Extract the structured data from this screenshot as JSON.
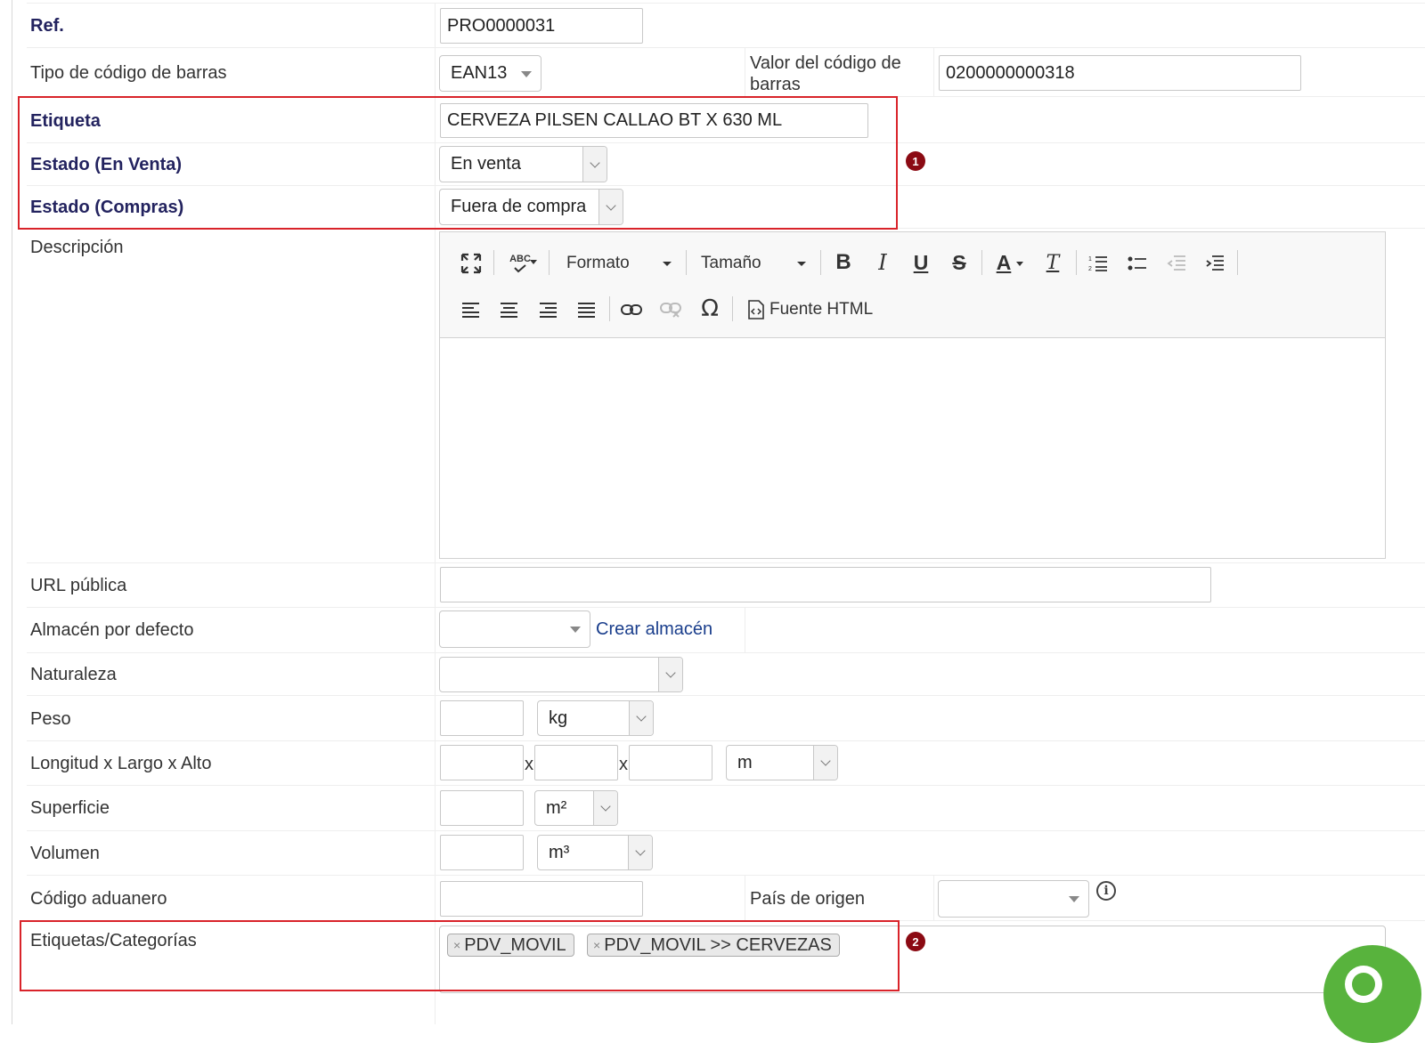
{
  "form": {
    "ref": {
      "label": "Ref.",
      "value": "PRO0000031"
    },
    "barcode_type": {
      "label": "Tipo de código de barras",
      "value": "EAN13"
    },
    "barcode_value": {
      "label": "Valor del código de barras",
      "value": "0200000000318"
    },
    "etiqueta": {
      "label": "Etiqueta",
      "value": "CERVEZA PILSEN CALLAO BT X 630 ML"
    },
    "estado_venta": {
      "label": "Estado (En Venta)",
      "value": "En venta"
    },
    "estado_compras": {
      "label": "Estado (Compras)",
      "value": "Fuera de compra"
    },
    "descripcion": {
      "label": "Descripción"
    },
    "url_publica": {
      "label": "URL pública",
      "value": ""
    },
    "almacen": {
      "label": "Almacén por defecto",
      "value": "",
      "link": "Crear almacén"
    },
    "naturaleza": {
      "label": "Naturaleza",
      "value": ""
    },
    "peso": {
      "label": "Peso",
      "value": "",
      "unit": "kg"
    },
    "dimensiones": {
      "label": "Longitud x Largo x Alto",
      "sep": "x",
      "unit": "m"
    },
    "superficie": {
      "label": "Superficie",
      "value": "",
      "unit": "m²"
    },
    "volumen": {
      "label": "Volumen",
      "value": "",
      "unit": "m³"
    },
    "codigo_aduanero": {
      "label": "Código aduanero",
      "value": ""
    },
    "pais_origen": {
      "label": "País de origen",
      "value": ""
    },
    "categorias": {
      "label": "Etiquetas/Categorías",
      "tags": [
        "PDV_MOVIL",
        "PDV_MOVIL >> CERVEZAS"
      ]
    }
  },
  "editor": {
    "formato": "Formato",
    "tamano": "Tamaño",
    "fuente_html": "Fuente HTML",
    "bold": "B",
    "italic": "I",
    "underline": "U",
    "strike": "S",
    "spell": "ABC",
    "special_char": "Ω",
    "text_color": "A",
    "remove_format": "T"
  },
  "badges": {
    "one": "1",
    "two": "2"
  },
  "tag_remove": "×",
  "colors": {
    "required_label": "#23235f",
    "highlight_box": "#d9232a",
    "badge": "#8b0a13",
    "chat": "#58b33d",
    "link": "#1a3e8c"
  }
}
